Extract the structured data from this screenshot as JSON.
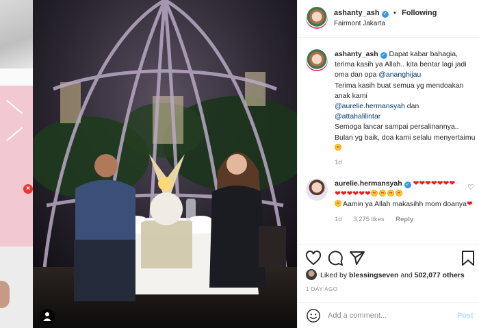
{
  "post": {
    "username": "ashanty_ash",
    "follow_status": "Following",
    "separator": "•",
    "location": "Fairmont Jakarta"
  },
  "caption": {
    "username": "ashanty_ash",
    "text_1": "Dapat kabar bahagia, terima kasih ya Allah.. kita bentar lagi jadi oma dan opa ",
    "mention_1": "@ananghijau",
    "text_2": "Terima kasih buat semua yg mendoakan anak kami",
    "mention_2": "@aurelie.hermansyah",
    "text_3": " dan",
    "mention_3": "@attahalilintar",
    "text_4": "Semoga lancar sampai persalinannya.. Bulan yg baik, doa kami selalu menyertaimu",
    "age": "1d"
  },
  "reply": {
    "username": "aurelie.hermansyah",
    "hearts_line": "❤❤❤❤❤❤❤",
    "text": "Aamin ya Allah makasihh mom doanya",
    "age": "1d",
    "likes": "3,275 likes",
    "reply_label": "Reply"
  },
  "likes": {
    "prefix": "Liked by ",
    "liker": "blessingseven",
    "middle": " and ",
    "others": "502,077 others"
  },
  "timestamp": "1 DAY AGO",
  "comment_box": {
    "placeholder": "Add a comment...",
    "post_label": "Post"
  },
  "backdrop": {
    "close_icon": "close-icon",
    "close_glyph": "×"
  },
  "icons": {
    "like": "heart-outline-icon",
    "comment": "speech-bubble-icon",
    "share": "paper-plane-icon",
    "save": "bookmark-icon",
    "emoji": "smiley-icon",
    "tag": "user-tag-icon"
  },
  "colors": {
    "verified": "#3897f0",
    "link": "#00376b",
    "muted": "#8e8e8e",
    "post_disabled": "#b2dffc",
    "heart": "#ed1c24"
  }
}
